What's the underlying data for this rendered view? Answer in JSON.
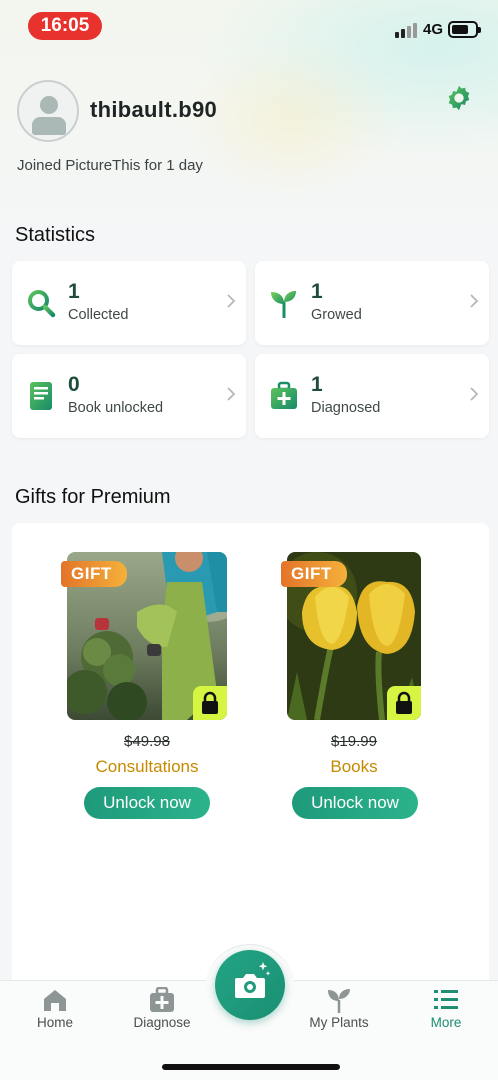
{
  "status_bar": {
    "time": "16:05",
    "network": "4G"
  },
  "profile": {
    "username": "thibault.b90",
    "joined": "Joined PictureThis for 1 day"
  },
  "statistics": {
    "title": "Statistics",
    "cards": [
      {
        "value": "1",
        "label": "Collected",
        "icon": "search-icon"
      },
      {
        "value": "1",
        "label": "Growed",
        "icon": "sprout-icon"
      },
      {
        "value": "0",
        "label": "Book unlocked",
        "icon": "book-icon"
      },
      {
        "value": "1",
        "label": "Diagnosed",
        "icon": "medkit-icon"
      }
    ]
  },
  "gifts": {
    "title": "Gifts for Premium",
    "items": [
      {
        "tag": "GIFT",
        "price": "$49.98",
        "name": "Consultations",
        "button": "Unlock now"
      },
      {
        "tag": "GIFT",
        "price": "$19.99",
        "name": "Books",
        "button": "Unlock now"
      }
    ]
  },
  "tabbar": {
    "tabs": [
      {
        "label": "Home",
        "icon": "home-icon"
      },
      {
        "label": "Diagnose",
        "icon": "medkit-icon"
      },
      {
        "label": "My Plants",
        "icon": "sprout-icon"
      },
      {
        "label": "More",
        "icon": "list-icon",
        "active": true
      }
    ],
    "camera_icon": "camera-icon"
  },
  "colors": {
    "accent": "#1e8f72",
    "gift_price": "#c48a00",
    "lock_badge": "#d6f542",
    "time_pill": "#e8322e"
  }
}
